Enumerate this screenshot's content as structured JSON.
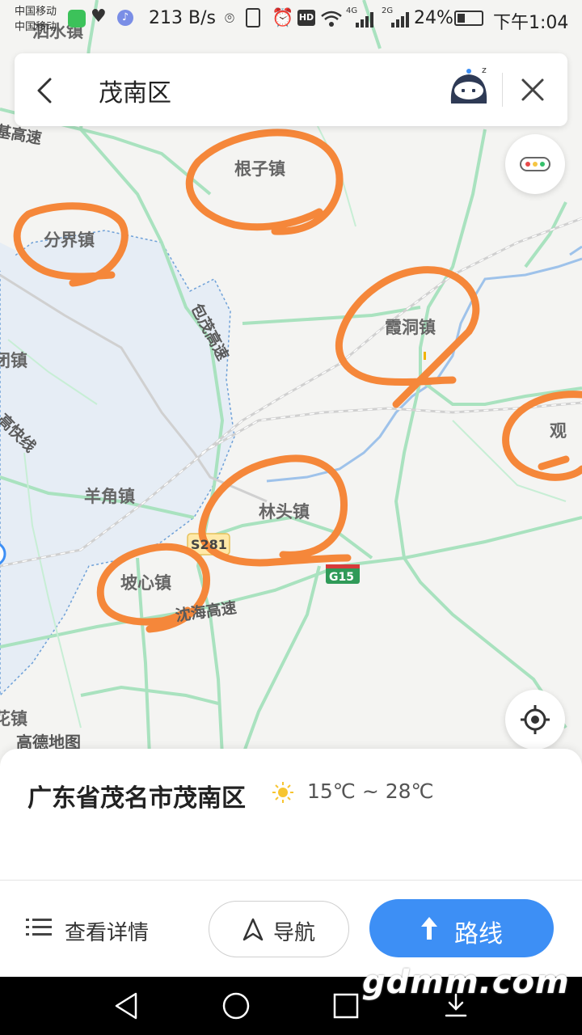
{
  "status_bar": {
    "carrier_1": "中国移动",
    "carrier_2": "中国移动",
    "speed": "213 B/s",
    "network_1": "4G",
    "network_2": "2G",
    "battery": "24%",
    "time": "下午1:04"
  },
  "search": {
    "query": "茂南区"
  },
  "map": {
    "towns": {
      "genzi": "根子镇",
      "fenjie": "分界镇",
      "xiadong": "霞洞镇",
      "guan": "观",
      "yangjiao": "羊角镇",
      "lintou": "林头镇",
      "poxin": "坡心镇",
      "left_tang": "闭镇",
      "left_hua": "花镇",
      "top_shui": "泗水镇"
    },
    "roads": {
      "baomao": "包茂高速",
      "shenhai": "沈海高速",
      "s281": "S281",
      "g15": "G15",
      "top_left_highway": "基高速",
      "left_rail": "高快线"
    },
    "attribution": "高德地图"
  },
  "place_sheet": {
    "place_name": "广东省茂名市茂南区",
    "weather_range": "15℃ ~ 28℃",
    "details_label": "查看详情",
    "navigate_label": "导航",
    "route_label": "路线"
  },
  "watermark": "gdmm.com",
  "colors": {
    "route_button": "#3d8ff5",
    "annotation_circle": "#f5873a",
    "highway_line": "#8ed9a8",
    "water": "#e6edf5"
  }
}
